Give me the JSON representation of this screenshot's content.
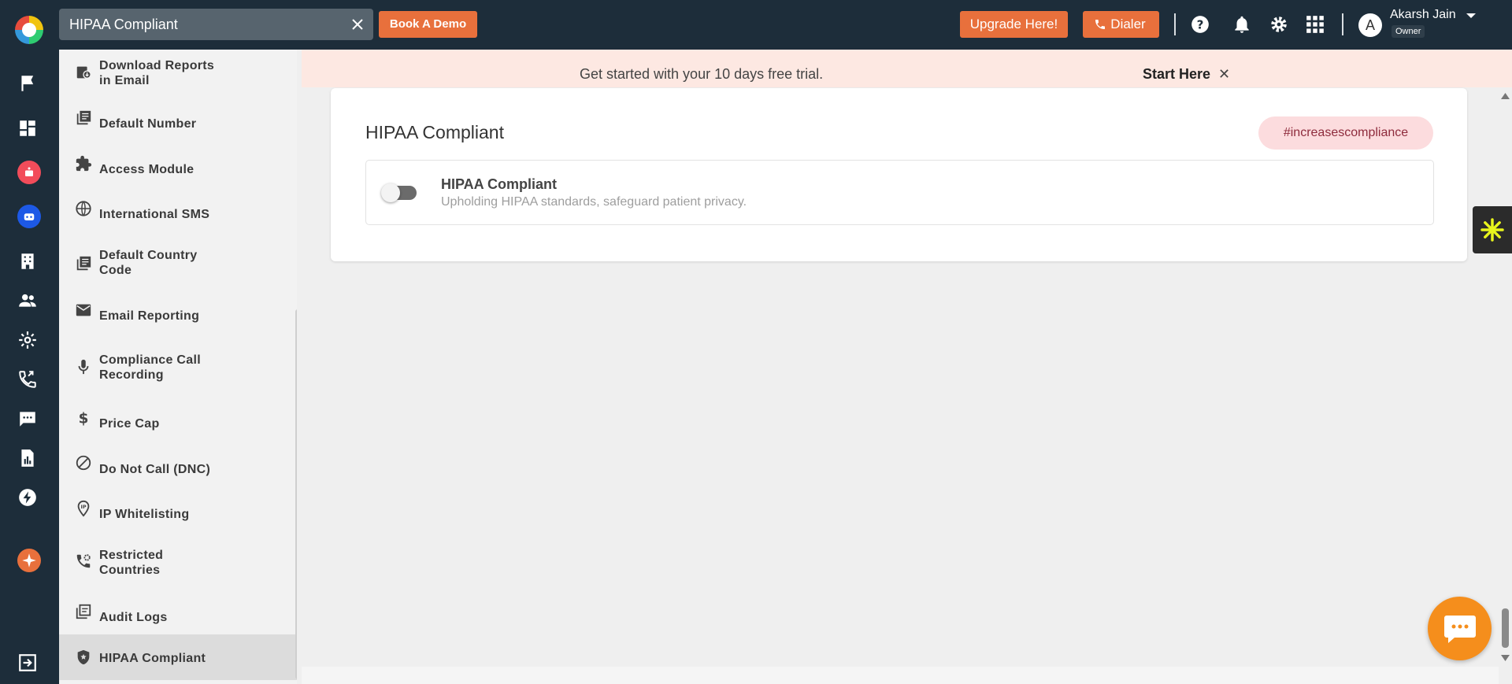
{
  "topbar": {
    "search_value": "HIPAA Compliant",
    "book_demo": "Book A Demo",
    "upgrade": "Upgrade Here!",
    "dialer": "Dialer",
    "user": {
      "initial": "A",
      "name": "Akarsh Jain",
      "role": "Owner"
    }
  },
  "banner": {
    "text": "Get started with your 10 days free trial.",
    "link": "Start Here",
    "close": "✕"
  },
  "sidebar": {
    "items": [
      {
        "l1": "Download Reports",
        "l2": "in Email",
        "icon": "download-icon"
      },
      {
        "l1": "Default Number",
        "l2": "",
        "icon": "list-icon"
      },
      {
        "l1": "Access Module",
        "l2": "",
        "icon": "puzzle-icon"
      },
      {
        "l1": "International SMS",
        "l2": "",
        "icon": "globe-icon"
      },
      {
        "l1": "Default Country",
        "l2": "Code",
        "icon": "list-icon"
      },
      {
        "l1": "Email Reporting",
        "l2": "",
        "icon": "mail-icon"
      },
      {
        "l1": "Compliance Call",
        "l2": "Recording",
        "icon": "mic-icon"
      },
      {
        "l1": "Price Cap",
        "l2": "",
        "icon": "dollar-icon"
      },
      {
        "l1": "Do Not Call (DNC)",
        "l2": "",
        "icon": "block-icon"
      },
      {
        "l1": "IP Whitelisting",
        "l2": "",
        "icon": "ip-pin-icon"
      },
      {
        "l1": "Restricted",
        "l2": "Countries",
        "icon": "phone-settings-icon"
      },
      {
        "l1": "Audit Logs",
        "l2": "",
        "icon": "library-icon"
      },
      {
        "l1": "HIPAA Compliant",
        "l2": "",
        "icon": "shield-icon"
      }
    ]
  },
  "card": {
    "title": "HIPAA Compliant",
    "tag": "#increasescompliance",
    "setting": {
      "title": "HIPAA Compliant",
      "description": "Upholding HIPAA standards, safeguard patient privacy.",
      "enabled": false
    }
  }
}
